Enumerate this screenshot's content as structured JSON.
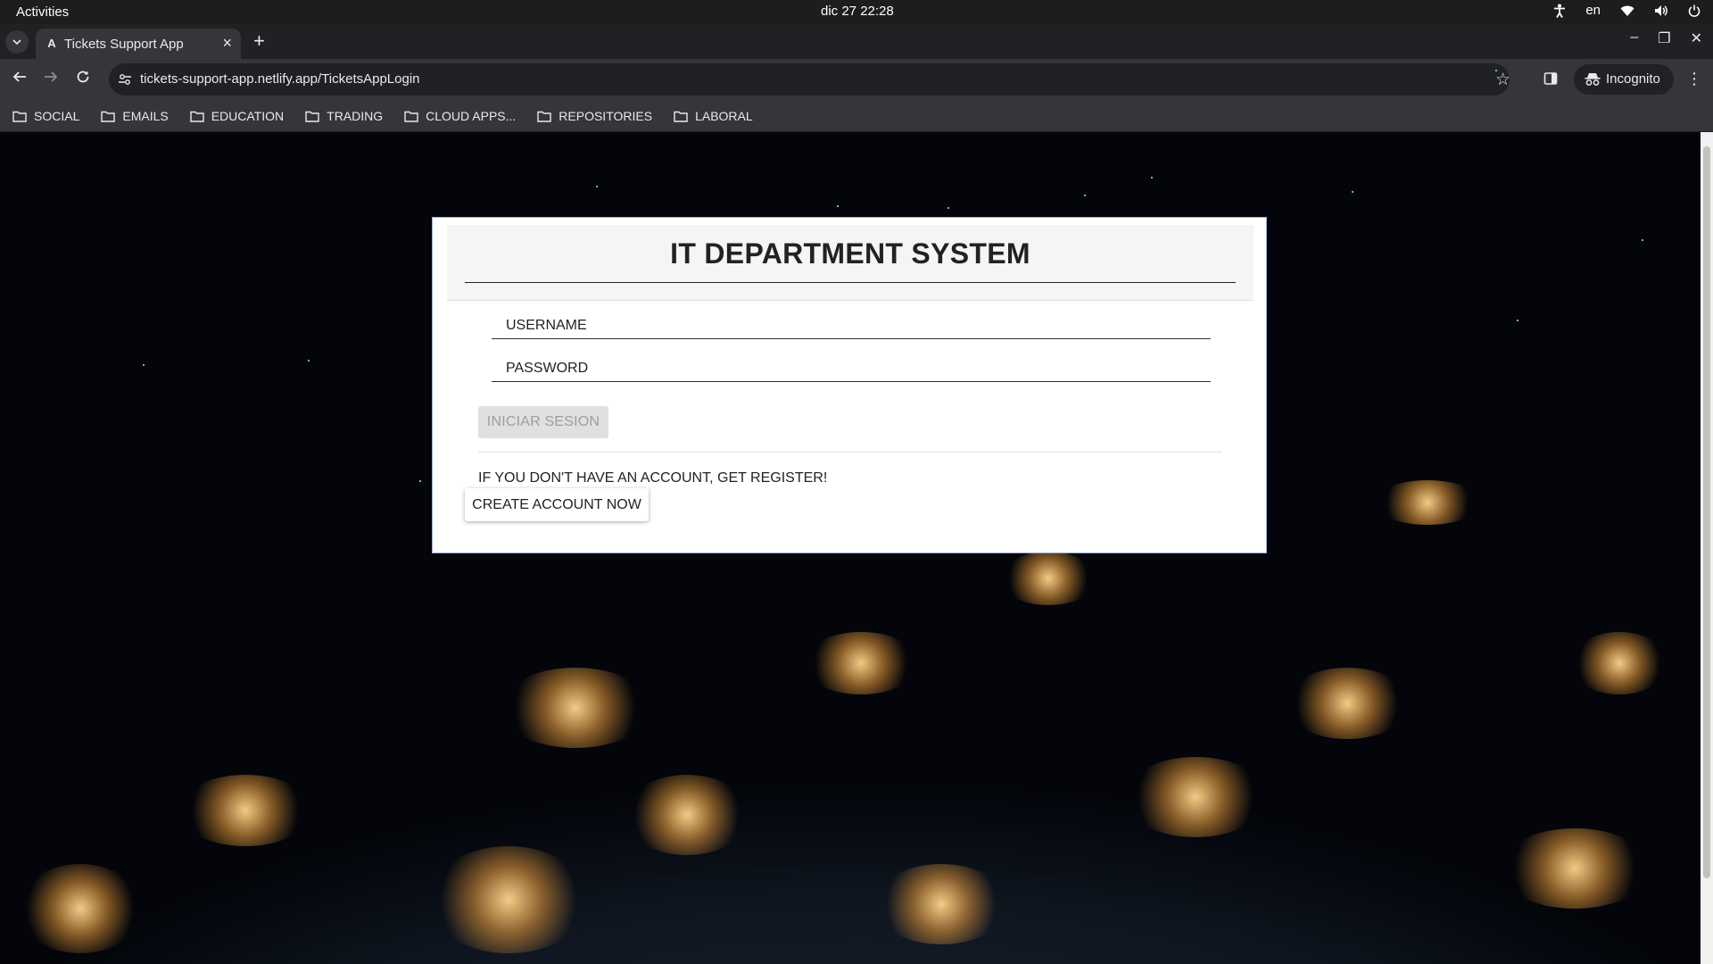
{
  "system": {
    "activities": "Activities",
    "clock": "dic 27  22:28",
    "language": "en"
  },
  "browser": {
    "tab_title": "Tickets Support App",
    "tab_favicon": "A",
    "url": "tickets-support-app.netlify.app/TicketsAppLogin",
    "incognito_label": "Incognito",
    "bookmarks": [
      "SOCIAL",
      "EMAILS",
      "EDUCATION",
      "TRADING",
      "CLOUD APPS...",
      "REPOSITORIES",
      "LABORAL"
    ]
  },
  "login": {
    "title": "IT DEPARTMENT SYSTEM",
    "username_placeholder": "USERNAME",
    "password_placeholder": "PASSWORD",
    "login_button": "INICIAR SESION",
    "register_prompt": "IF YOU DON'T HAVE AN ACCOUNT, GET REGISTER!",
    "create_account_button": "CREATE ACCOUNT NOW"
  },
  "colors": {
    "topbar": "#1d1d1d",
    "chrome_dark": "#202124",
    "chrome_toolbar": "#35363a",
    "card_border": "#99aadd",
    "disabled_button": "#e0e0e0"
  }
}
